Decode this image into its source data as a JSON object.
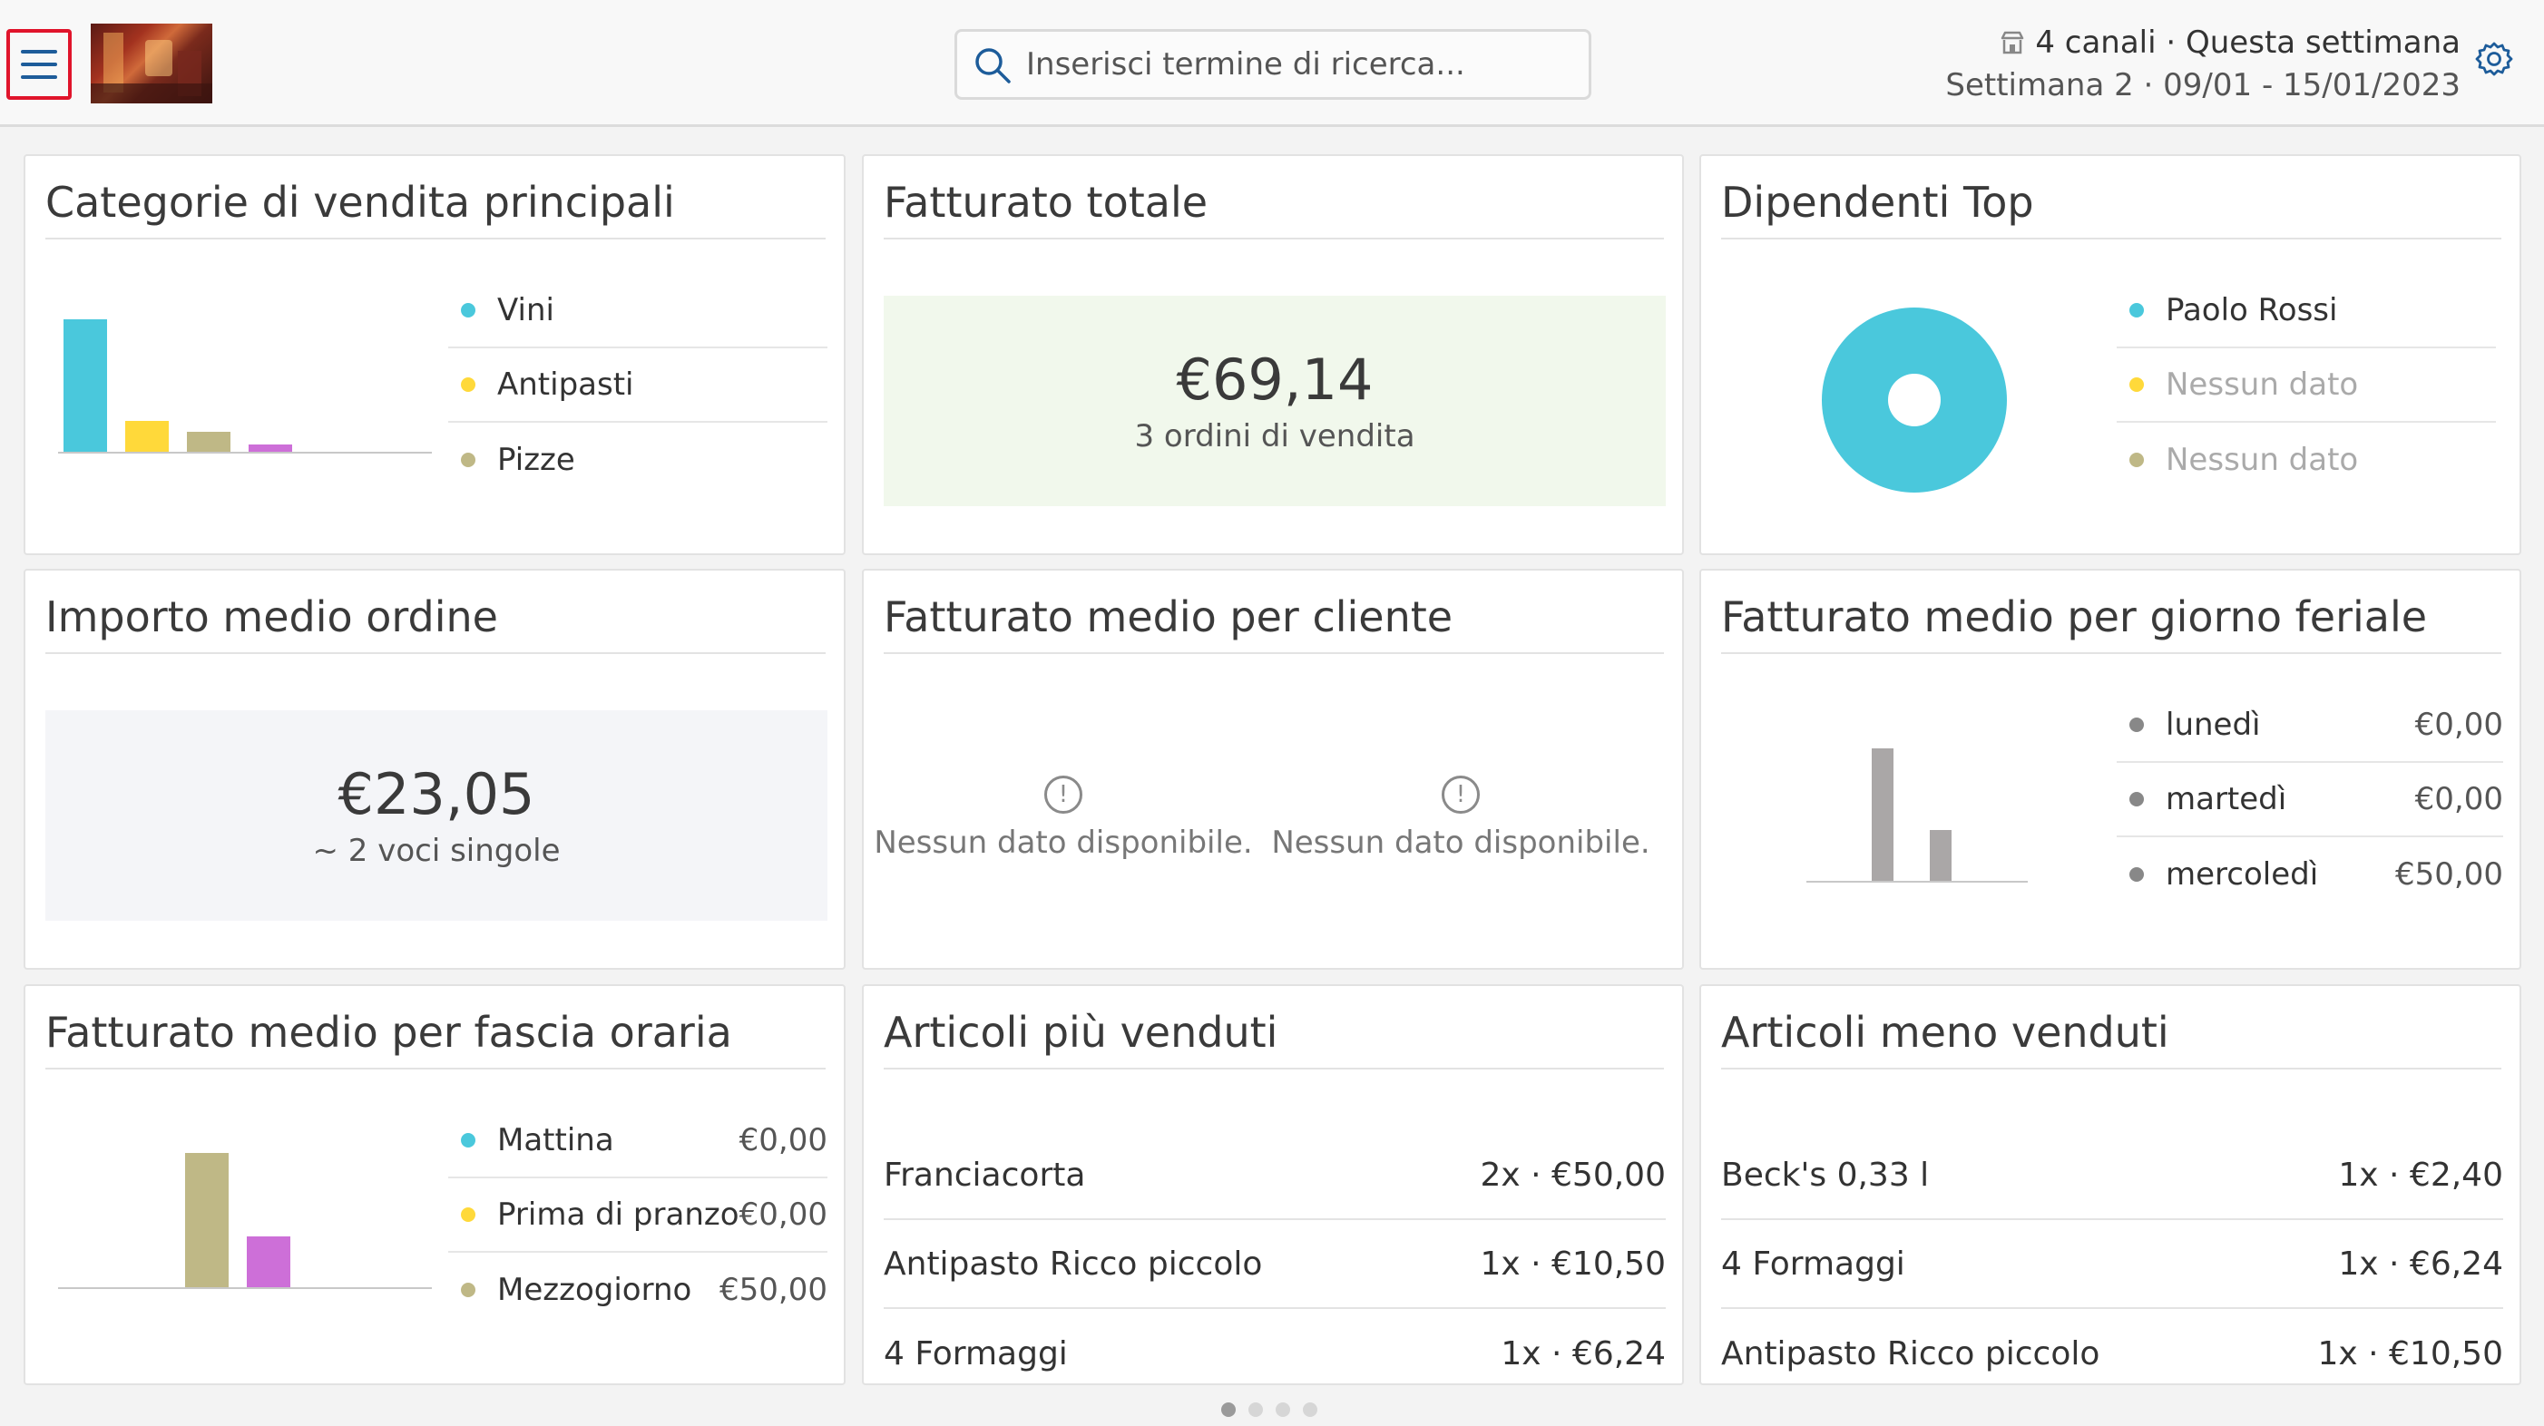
{
  "header": {
    "search_placeholder": "Inserisci termine di ricerca...",
    "channels_label": "4 canali · Questa settimana",
    "week_label": "Settimana 2 · 09/01 - 15/01/2023"
  },
  "cards": {
    "top_categories": {
      "title": "Categorie di vendita principali",
      "items": [
        {
          "label": "Vini",
          "color": "#4ac8dc"
        },
        {
          "label": "Antipasti",
          "color": "#ffd93a"
        },
        {
          "label": "Pizze",
          "color": "#bfb886"
        }
      ],
      "extra_series_color": "#cd6fd8"
    },
    "total_revenue": {
      "title": "Fatturato totale",
      "amount": "€69,14",
      "subtitle": "3 ordini di vendita"
    },
    "top_employees": {
      "title": "Dipendenti Top",
      "items": [
        {
          "label": "Paolo Rossi",
          "color": "#4ac8dc"
        },
        {
          "label": "Nessun dato",
          "color": "#ffd93a"
        },
        {
          "label": "Nessun dato",
          "color": "#bfb886"
        }
      ]
    },
    "avg_order": {
      "title": "Importo medio ordine",
      "amount": "€23,05",
      "subtitle": "~ 2 voci singole"
    },
    "avg_per_customer": {
      "title": "Fatturato medio per cliente",
      "empty_left": "Nessun dato disponibile.",
      "empty_right": "Nessun dato disponibile."
    },
    "avg_per_weekday": {
      "title": "Fatturato medio per giorno feriale",
      "items": [
        {
          "label": "lunedì",
          "value": "€0,00",
          "color": "#888888"
        },
        {
          "label": "martedì",
          "value": "€0,00",
          "color": "#888888"
        },
        {
          "label": "mercoledì",
          "value": "€50,00",
          "color": "#888888"
        }
      ]
    },
    "avg_per_timeslot": {
      "title": "Fatturato medio per fascia oraria",
      "items": [
        {
          "label": "Mattina",
          "value": "€0,00",
          "color": "#4ac8dc"
        },
        {
          "label": "Prima di pranzo",
          "value": "€0,00",
          "color": "#ffd93a"
        },
        {
          "label": "Mezzogiorno",
          "value": "€50,00",
          "color": "#bfb886"
        }
      ],
      "extra_series_color": "#cd6fd8"
    },
    "best_sellers": {
      "title": "Articoli più venduti",
      "rows": [
        {
          "name": "Franciacorta",
          "value": "2x · €50,00"
        },
        {
          "name": "Antipasto Ricco piccolo",
          "value": "1x · €10,50"
        },
        {
          "name": "4 Formaggi",
          "value": "1x · €6,24"
        }
      ]
    },
    "worst_sellers": {
      "title": "Articoli meno venduti",
      "rows": [
        {
          "name": "Beck's 0,33 l",
          "value": "1x · €2,40"
        },
        {
          "name": "4 Formaggi",
          "value": "1x · €6,24"
        },
        {
          "name": "Antipasto Ricco piccolo",
          "value": "1x · €10,50"
        }
      ]
    }
  },
  "pager": {
    "pages": 4,
    "active": 1
  },
  "chart_data": [
    {
      "type": "bar",
      "categories": [
        "Vini",
        "Antipasti",
        "Pizze",
        ""
      ],
      "values": [
        1,
        0.22,
        0.12,
        0.05
      ]
    },
    {
      "type": "pie",
      "categories": [
        "Paolo Rossi"
      ],
      "values": [
        100
      ]
    },
    {
      "type": "bar",
      "categories": [
        "",
        ""
      ],
      "values": [
        1,
        0.38
      ]
    },
    {
      "type": "bar",
      "categories": [
        "Prima di pranzo",
        "Mezzogiorno"
      ],
      "values": [
        1,
        0.38
      ]
    }
  ]
}
